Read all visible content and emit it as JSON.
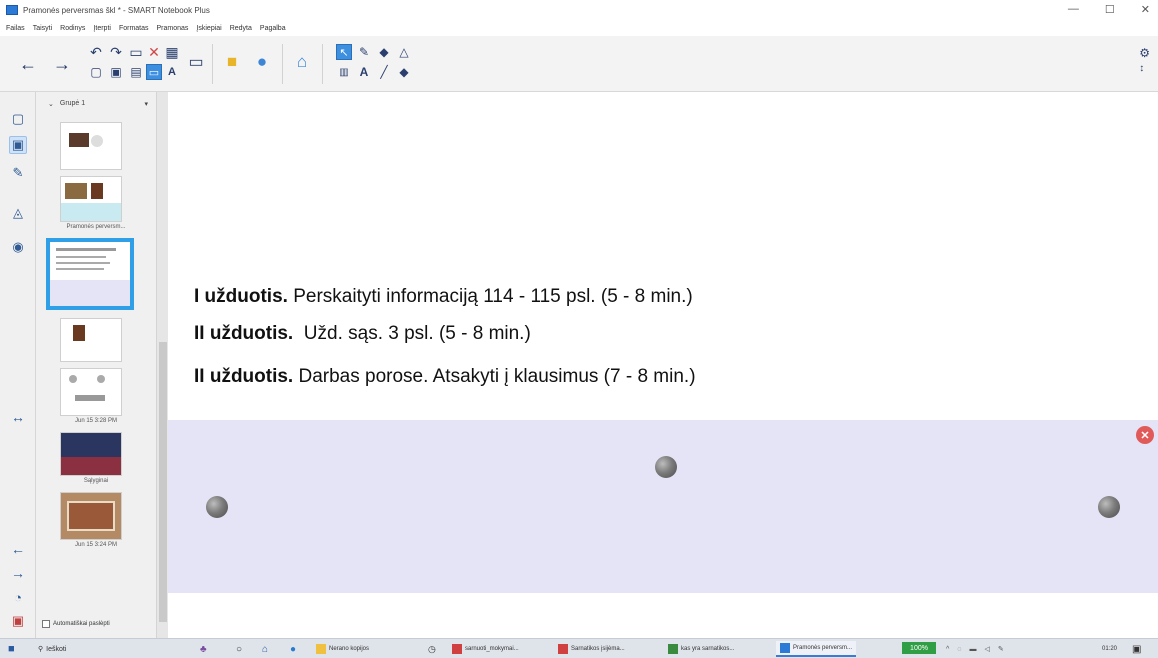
{
  "window": {
    "title": "Pramonės perversmas škl * - SMART Notebook Plus",
    "controls": [
      "—",
      "☐",
      "✕"
    ]
  },
  "menu": [
    "Failas",
    "Taisyti",
    "Rodinys",
    "Įterpti",
    "Formatas",
    "Pramonas",
    "Įskiepiai",
    "Redyta",
    "Pagalba"
  ],
  "sorter": {
    "group_label": "Grupė 1",
    "thumb_labels": [
      "Pramonės perversm...",
      "Jun 15 3:28 PM",
      "Sąlyginai",
      "Jun 15 3:24 PM"
    ],
    "auto_hide_label": "Automatiškai paslėpti"
  },
  "canvas": {
    "tasks": [
      {
        "label": "I užduotis.",
        "text": " Perskaityti informaciją 114 - 115 psl. (5 - 8 min.)"
      },
      {
        "label": "II užduotis.",
        "text": "  Užd. sąs. 3 psl. (5 - 8 min.)"
      },
      {
        "label": "II užduotis.",
        "text": " Darbas porose. Atsakyti į klausimus (7 - 8 min.)"
      }
    ]
  },
  "taskbar": {
    "search_label": "Ieškoti",
    "items": [
      "Nerano kopijos",
      "sarnuoti_mokymai...",
      "Sarnatikos įsijėma...",
      "kas yra sarnatikos...",
      "Pramonės perversm..."
    ],
    "zoom": "100%",
    "clock": "01:20"
  },
  "colors": {
    "shade": "#e5e4f6",
    "selected_thumb": "#2fa0e8",
    "close_button": "#e05a5a"
  },
  "icons": [
    "back-icon",
    "forward-icon",
    "undo-icon",
    "redo-icon",
    "delete-icon",
    "select-icon",
    "pen-icon",
    "eraser-icon",
    "shapes-icon",
    "text-icon",
    "line-icon",
    "fill-icon",
    "settings-icon"
  ]
}
